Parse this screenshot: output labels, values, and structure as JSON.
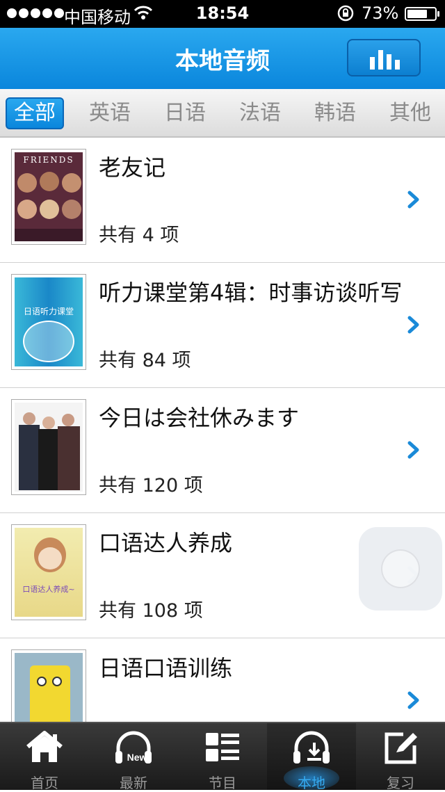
{
  "status_bar": {
    "carrier": "中国移动",
    "time": "18:54",
    "battery_percent": "73%",
    "battery_level": 0.73
  },
  "header": {
    "title": "本地音频",
    "equalizer_icon": "equalizer-icon"
  },
  "tabs": [
    {
      "label": "全部",
      "active": true
    },
    {
      "label": "英语",
      "active": false
    },
    {
      "label": "日语",
      "active": false
    },
    {
      "label": "法语",
      "active": false
    },
    {
      "label": "韩语",
      "active": false
    },
    {
      "label": "其他",
      "active": false
    }
  ],
  "items": [
    {
      "title": "老友记",
      "count": "共有 4 项",
      "cover_text": "FRIENDS"
    },
    {
      "title": "听力课堂第4辑：时事访谈听写",
      "count": "共有 84 项",
      "cover_text": "日语听力课堂"
    },
    {
      "title": "今日は会社休みます",
      "count": "共有 120 项"
    },
    {
      "title": "口语达人养成",
      "count": "共有 108 项",
      "cover_text": "口语达人养成~"
    },
    {
      "title": "日语口语训练",
      "count": ""
    }
  ],
  "bottom_tabs": [
    {
      "label": "首页",
      "icon": "home-icon",
      "active": false
    },
    {
      "label": "最新",
      "icon": "headphones-new-icon",
      "badge": "New",
      "active": false
    },
    {
      "label": "节目",
      "icon": "list-icon",
      "active": false
    },
    {
      "label": "本地",
      "icon": "headphones-download-icon",
      "active": true
    },
    {
      "label": "复习",
      "icon": "edit-icon",
      "active": false
    }
  ],
  "colors": {
    "accent": "#0a86dc",
    "active_tab_label": "#35aaf0",
    "chevron": "#1a8ad8"
  }
}
